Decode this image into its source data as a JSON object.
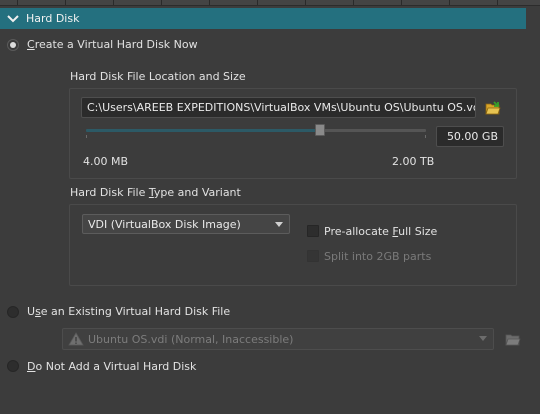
{
  "section": {
    "title": "Hard Disk"
  },
  "options": {
    "create_new": {
      "label_first": "C",
      "label_rest": "reate a Virtual Hard Disk Now"
    },
    "use_existing": {
      "label_first": "U",
      "label_mid": "s",
      "label_rest": "e an Existing Virtual Hard Disk File"
    },
    "do_not_add": {
      "label_first": "D",
      "label_rest": "o Not Add a Virtual Hard Disk"
    }
  },
  "location_group": {
    "title": "Hard Disk File Location and Size",
    "file_path": "C:\\Users\\AREEB EXPEDITIONS\\VirtualBox VMs\\Ubuntu OS\\Ubuntu OS.vdi",
    "size_value": "50.00 GB",
    "slider_fraction": 0.688,
    "min_label": "4.00 MB",
    "max_label": "2.00 TB"
  },
  "type_group": {
    "title_pre": "Hard Disk File ",
    "title_u": "T",
    "title_post": "ype and Variant",
    "disk_type": "VDI (VirtualBox Disk Image)",
    "preallocate_pre": "Pre-allocate ",
    "preallocate_u": "F",
    "preallocate_post": "ull Size",
    "split_label": "Split into 2GB parts"
  },
  "existing": {
    "selected": "Ubuntu OS.vdi (Normal, Inaccessible)"
  },
  "colors": {
    "header": "#24707f",
    "background": "#3c3c3c"
  },
  "icons": [
    "chevron-down-icon",
    "folder-open-icon",
    "warning-icon",
    "folder-icon"
  ]
}
